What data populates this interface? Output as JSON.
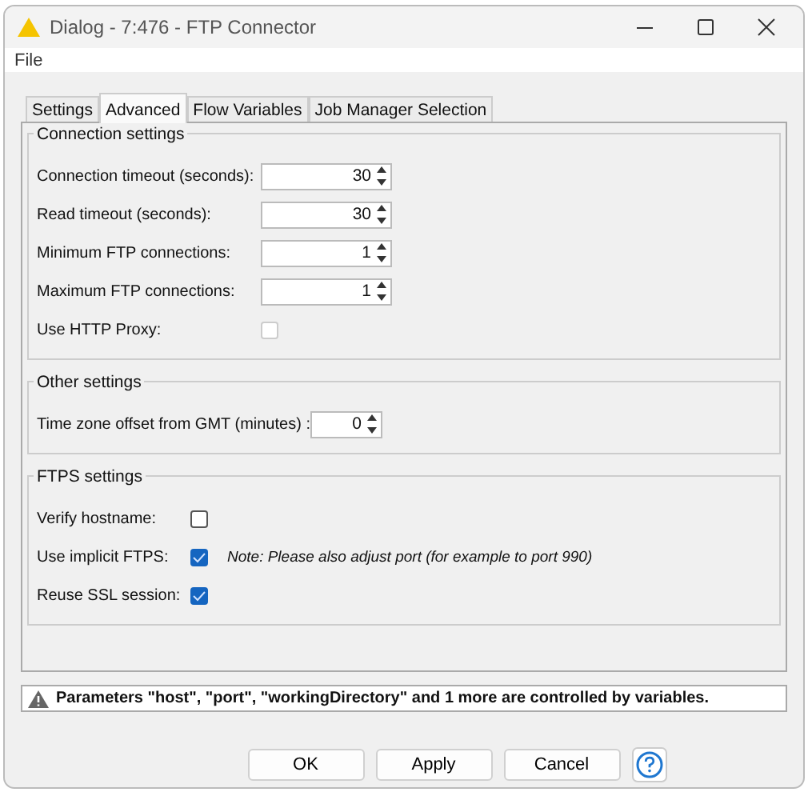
{
  "window": {
    "title": "Dialog - 7:476 - FTP Connector"
  },
  "menu": [
    "File"
  ],
  "tabs": [
    {
      "label": "Settings",
      "selected": false
    },
    {
      "label": "Advanced",
      "selected": true
    },
    {
      "label": "Flow Variables",
      "selected": false
    },
    {
      "label": "Job Manager Selection",
      "selected": false
    }
  ],
  "groups": [
    {
      "title": "Connection settings",
      "rows": [
        {
          "kind": "spinner",
          "label": "Connection timeout (seconds):",
          "value": "30"
        },
        {
          "kind": "spinner",
          "label": "Read timeout (seconds):",
          "value": "30"
        },
        {
          "kind": "spinner",
          "label": "Minimum FTP connections:",
          "value": "1"
        },
        {
          "kind": "spinner",
          "label": "Maximum FTP connections:",
          "value": "1"
        },
        {
          "kind": "checkbox",
          "label": "Use HTTP Proxy:",
          "checked": false,
          "disabled": true
        }
      ]
    },
    {
      "title": "Other settings",
      "rows": [
        {
          "kind": "spinner_small",
          "label": "Time zone offset from GMT (minutes)  :",
          "value": "0"
        }
      ]
    },
    {
      "title": "FTPS settings",
      "rows": [
        {
          "kind": "checkbox",
          "label": "Verify hostname:",
          "checked": false,
          "disabled": false
        },
        {
          "kind": "checkbox",
          "label": "Use implicit FTPS:",
          "checked": true,
          "disabled": false,
          "note": "Note: Please also adjust port (for example to port 990)"
        },
        {
          "kind": "checkbox",
          "label": "Reuse SSL session:",
          "checked": true,
          "disabled": false
        }
      ]
    }
  ],
  "warning": "Parameters \"host\", \"port\", \"workingDirectory\" and 1 more are controlled by variables.",
  "buttons": [
    "OK",
    "Apply",
    "Cancel"
  ]
}
